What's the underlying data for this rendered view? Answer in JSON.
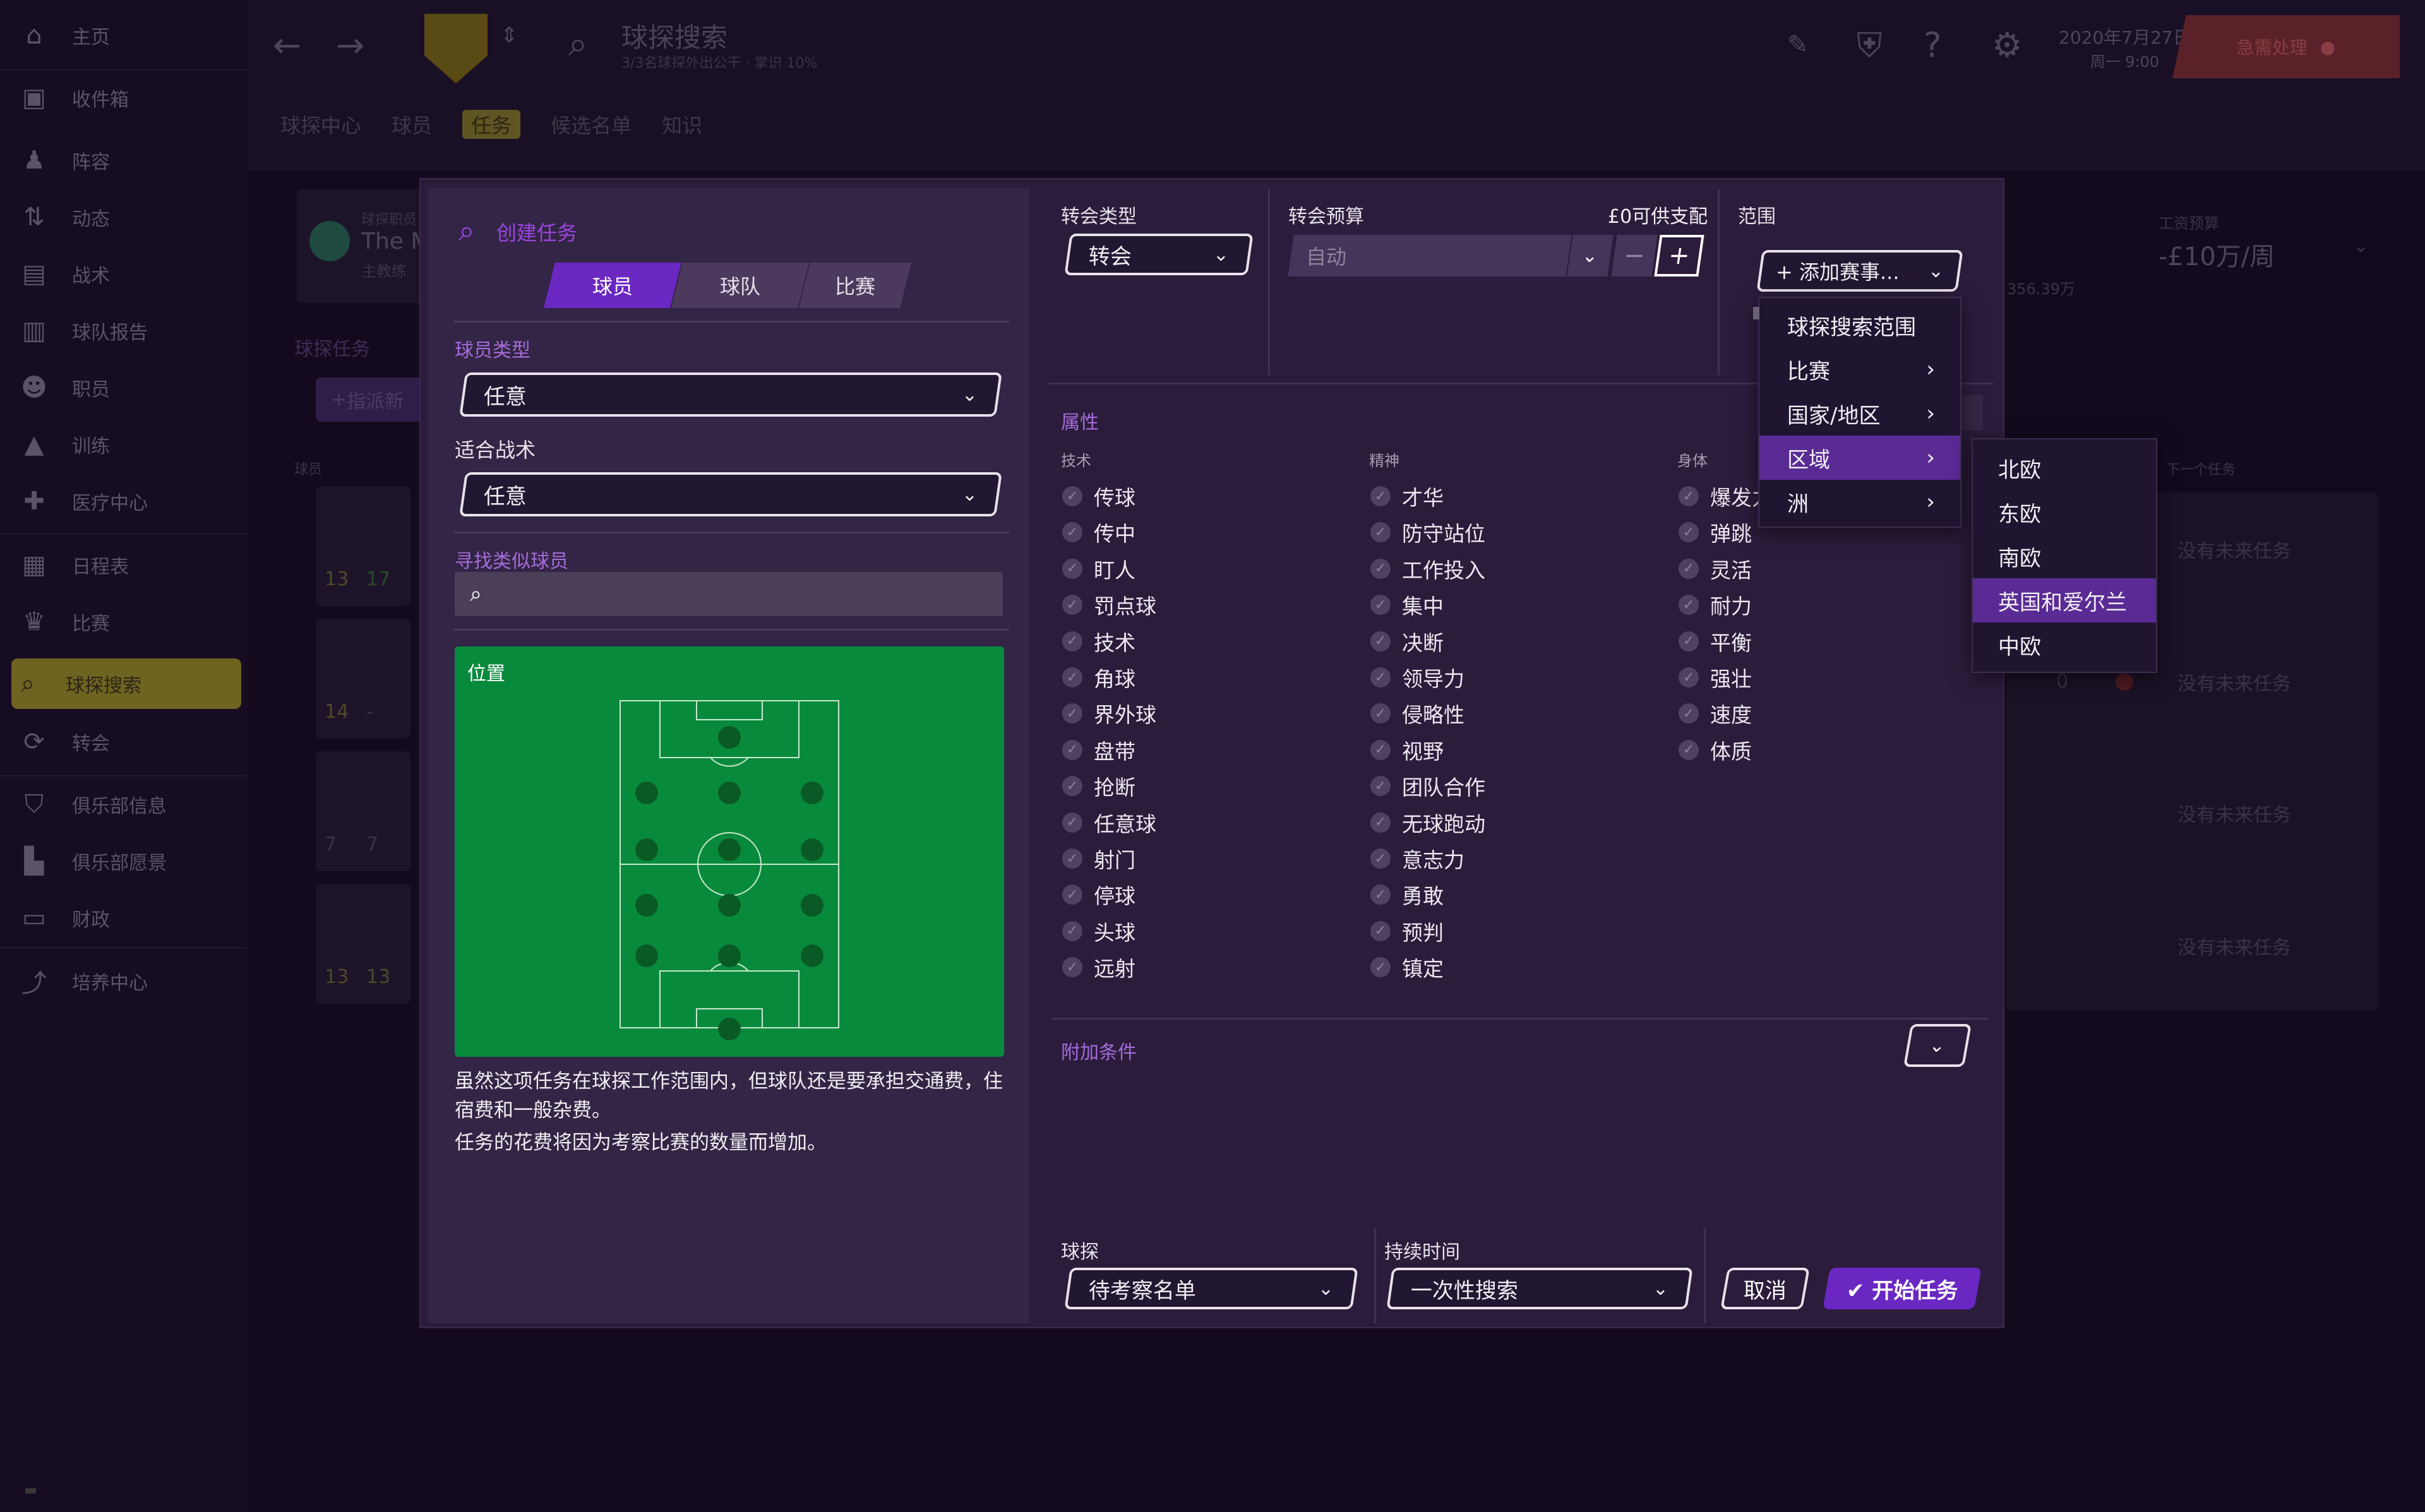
{
  "sidebar": {
    "items": [
      "主页",
      "收件箱",
      "阵容",
      "动态",
      "战术",
      "球队报告",
      "职员",
      "训练",
      "医疗中心",
      "日程表",
      "比赛",
      "球探搜索",
      "转会",
      "俱乐部信息",
      "俱乐部愿景",
      "财政",
      "培养中心"
    ]
  },
  "topbar": {
    "title": "球探搜索",
    "subtitle": "3/3名球探外出公干 · 掌识 10%",
    "date": "2020年7月27日",
    "day": "周一 9:00",
    "alert": "急需处理",
    "subnav": [
      "球探中心",
      "球员",
      "任务",
      "候选名单",
      "知识"
    ]
  },
  "background": {
    "panel_label": "球探职员",
    "panel_name": "The M",
    "panel_role": "主教练",
    "tasks_label": "球探任务",
    "assign_btn": "指派新",
    "col_player": "球员",
    "wage_label": "工资预算",
    "wage_value": "-£10万/周",
    "amount": "356.39万",
    "next_task": "下一个任务",
    "no_task": "没有未来任务",
    "row_nums": [
      [
        "13",
        "17"
      ],
      [
        "14",
        "-"
      ],
      [
        "7",
        "7"
      ],
      [
        "13",
        "13"
      ]
    ],
    "zero": "0"
  },
  "left": {
    "heading": "创建任务",
    "tabs": [
      "球员",
      "球队",
      "比赛"
    ],
    "player_type_label": "球员类型",
    "player_type_value": "任意",
    "tactic_label": "适合战术",
    "tactic_value": "任意",
    "similar_label": "寻找类似球员",
    "position_label": "位置",
    "note1": "虽然这项任务在球探工作范围内，但球队还是要承担交通费，住宿费和一般杂费。",
    "note2": "任务的花费将因为考察比赛的数量而增加。"
  },
  "transfer": {
    "type_label": "转会类型",
    "type_value": "转会",
    "budget_label": "转会预算",
    "budget_avail": "£0可供支配",
    "budget_value": "自动",
    "scope_label": "范围",
    "add_btn": "添加赛事..."
  },
  "attributes": {
    "label": "属性",
    "tech_label": "技术",
    "mental_label": "精神",
    "phys_label": "身体",
    "tech": [
      "传球",
      "传中",
      "盯人",
      "罚点球",
      "技术",
      "角球",
      "界外球",
      "盘带",
      "抢断",
      "任意球",
      "射门",
      "停球",
      "头球",
      "远射"
    ],
    "mental": [
      "才华",
      "防守站位",
      "工作投入",
      "集中",
      "决断",
      "领导力",
      "侵略性",
      "视野",
      "团队合作",
      "无球跑动",
      "意志力",
      "勇敢",
      "预判",
      "镇定"
    ],
    "phys": [
      "爆发力",
      "弹跳",
      "灵活",
      "耐力",
      "平衡",
      "强壮",
      "速度",
      "体质"
    ]
  },
  "extra": {
    "label": "附加条件"
  },
  "bottom": {
    "scout_label": "球探",
    "scout_value": "待考察名单",
    "duration_label": "持续时间",
    "duration_value": "一次性搜索",
    "cancel": "取消",
    "start": "开始任务"
  },
  "menu1": [
    "球探搜索范围",
    "比赛",
    "国家/地区",
    "区域",
    "洲"
  ],
  "menu2": [
    "北欧",
    "东欧",
    "南欧",
    "英国和爱尔兰",
    "中欧"
  ],
  "icons": [
    "home-icon",
    "inbox-icon",
    "squad-icon",
    "dynamics-icon",
    "tactics-icon",
    "report-icon",
    "staff-icon",
    "training-icon",
    "medical-icon",
    "schedule-icon",
    "trophy-icon",
    "scouting-icon",
    "transfer-icon",
    "club-info-icon",
    "vision-icon",
    "finance-icon",
    "development-icon"
  ]
}
